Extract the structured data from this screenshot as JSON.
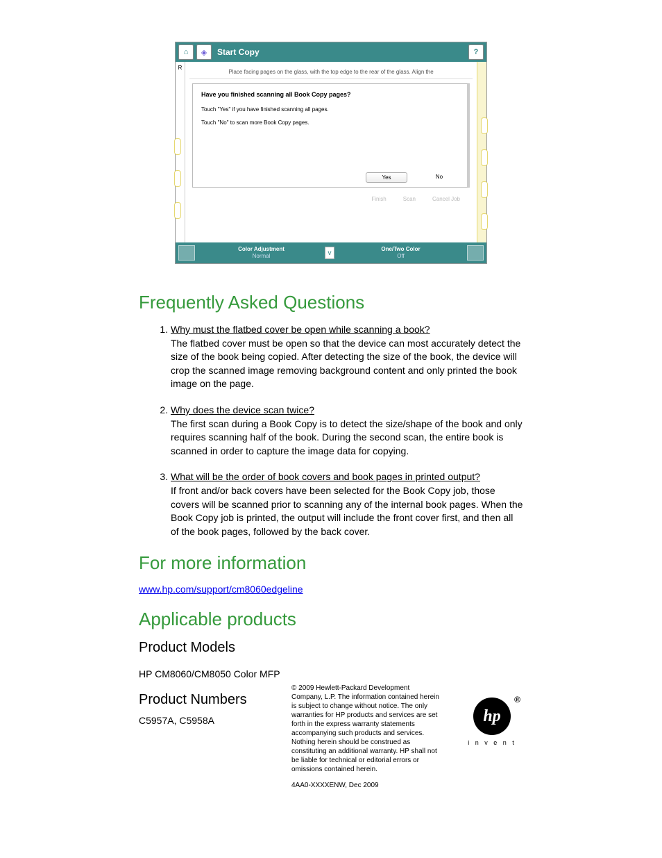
{
  "screenshot": {
    "title": "Start Copy",
    "rail_label": "R",
    "instruction": "Place facing pages on the glass, with the top edge to the rear of the glass. Align the",
    "dialog": {
      "heading": "Have you finished scanning all Book Copy pages?",
      "line1": "Touch \"Yes\" if you have finished scanning all pages.",
      "line2": "Touch \"No\" to scan more Book Copy pages.",
      "yes": "Yes",
      "no": "No"
    },
    "buttons": {
      "finish": "Finish",
      "scan": "Scan",
      "cancel": "Cancel Job"
    },
    "footer": {
      "left_label": "Color Adjustment",
      "left_value": "Normal",
      "right_label": "One/Two Color",
      "right_value": "Off"
    }
  },
  "faq": {
    "heading": "Frequently Asked Questions",
    "items": [
      {
        "q": "Why must the flatbed cover be open while scanning a book?",
        "a": "The flatbed cover must be open so that the device can most accurately detect the size of the book being copied.  After detecting the size of the book, the device will crop the scanned image removing background content and only printed the book image on the page."
      },
      {
        "q": "Why does the device scan twice?",
        "a": "The first scan during a Book Copy is to detect the size/shape of the book and only requires scanning half of the book. During the second scan, the entire book is scanned in order to capture the image data for copying."
      },
      {
        "q": "What will be the order of book covers and book pages in printed output?",
        "a": "If front and/or back covers have been selected for the Book Copy job, those covers will be scanned prior to scanning any of the internal book pages.  When the Book Copy job is printed, the output will include the front cover first, and then all of the book pages, followed by the back cover."
      }
    ]
  },
  "more_info": {
    "heading": "For more information",
    "link_text": "www.hp.com/support/cm8060edgeline"
  },
  "products": {
    "heading": "Applicable products",
    "models_heading": "Product Models",
    "models_text": "HP CM8060/CM8050 Color MFP",
    "numbers_heading": "Product Numbers",
    "numbers_text": "C5957A, C5958A"
  },
  "legal": {
    "copyright": "© 2009 Hewlett-Packard Development Company, L.P. The information contained herein is subject to change without notice. The only warranties for HP products and services are set forth in the express warranty statements accompanying such products and services. Nothing herein should be construed as constituting an additional warranty. HP shall not be liable for technical or editorial errors or omissions contained herein.",
    "docnum": "4AA0-XXXXENW, Dec 2009"
  },
  "logo": {
    "text": "hp",
    "tagline": "i n v e n t"
  }
}
